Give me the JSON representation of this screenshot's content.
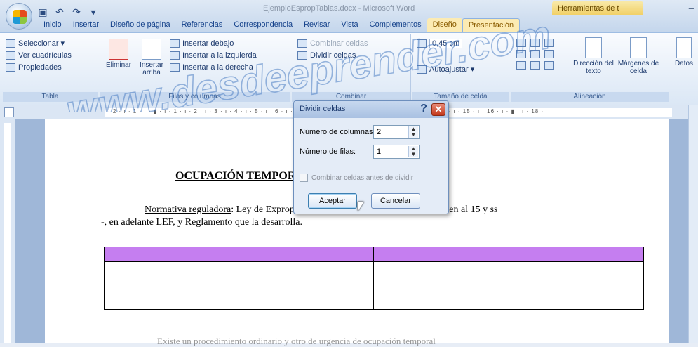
{
  "window": {
    "title": "EjemploEspropTablas.docx - Microsoft Word",
    "contextual_label": "Herramientas de t",
    "controls": [
      "–",
      "▭",
      "✕"
    ]
  },
  "qat": {
    "icons": [
      "save-icon",
      "undo-icon",
      "redo-icon",
      "customize-icon"
    ],
    "glyphs": [
      "▣",
      "↶",
      "↷",
      "▾"
    ]
  },
  "tabs": [
    "Inicio",
    "Insertar",
    "Diseño de página",
    "Referencias",
    "Correspondencia",
    "Revisar",
    "Vista",
    "Complementos",
    "Diseño",
    "Presentación"
  ],
  "ribbon": {
    "tabla_group": {
      "items": [
        "Seleccionar ▾",
        "Ver cuadrículas",
        "Propiedades"
      ],
      "label": "Tabla"
    },
    "filas_group": {
      "eliminar": "Eliminar",
      "insertar_arriba": "Insertar arriba",
      "items": [
        "Insertar debajo",
        "Insertar a la izquierda",
        "Insertar a la derecha"
      ],
      "label": "Filas y columnas"
    },
    "combinar_group": {
      "items": [
        "Combinar celdas",
        "Dividir celdas"
      ],
      "label": "Combinar"
    },
    "size_group": {
      "height_value": "0,45 cm",
      "autoajustar": "Autoajustar ▾",
      "label": "Tamaño de celda"
    },
    "alineacion_group": {
      "direccion": "Dirección del texto",
      "margenes": "Márgenes de celda",
      "label": "Alineación"
    },
    "datos": "Datos"
  },
  "ruler": "· 2 · ı · 1 · ı · ▮ · ı · 1 · ı · 2 · ı · 3 · ı · 4 · ı · 5 · ı · 6 · ı · 7 · ı · 8 · ı · 9 · ı · 10 · ı · 11 · ı · 12 · ▮ · ı · 14 · ı · 15 · ı · 16 · ı · ▮ · ı · 18 ·",
  "document": {
    "heading": "OCUPACIÓN TEMPORAL PARTICULAR",
    "para_label": "Normativa reguladora",
    "para_line1_rest": ": Ley de Expropiación Forzosa, art. 108 y ss., que remiten al 15 y ss",
    "para_line2": "-, en adelante LEF, y Reglamento que la desarrolla.",
    "bottom_text": "Existe un procedimiento ordinario y otro de urgencia de ocupación temporal"
  },
  "watermark": "www.desdeeprender.com",
  "dialog": {
    "title": "Dividir celdas",
    "help": "?",
    "close": "✕",
    "columns_label": "Número de columnas:",
    "columns_value": "2",
    "rows_label": "Número de filas:",
    "rows_value": "1",
    "merge_label": "Combinar celdas antes de dividir",
    "merge_checked": false,
    "ok": "Aceptar",
    "cancel": "Cancelar"
  },
  "colors": {
    "table_header": "#c57ef0",
    "close_button": "#c3381b",
    "ribbon_text": "#15428b"
  }
}
